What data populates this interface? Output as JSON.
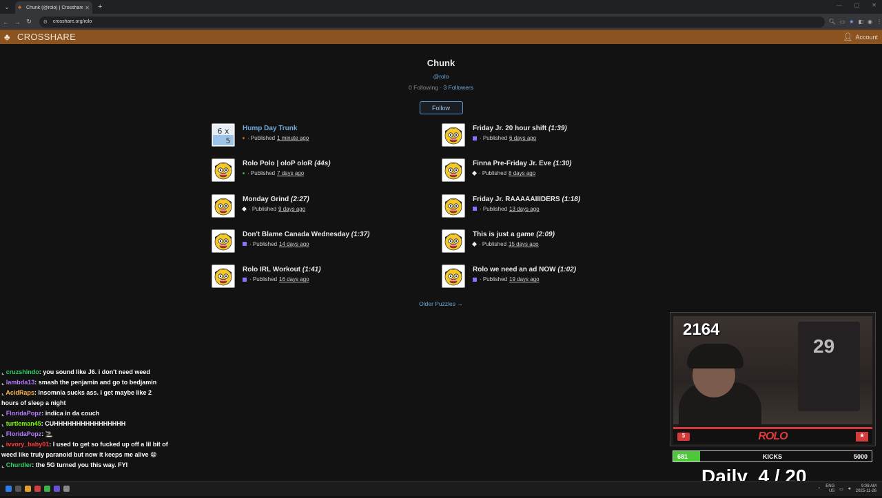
{
  "browser": {
    "tab_title": "Chunk (@rolo) | Crosshare Cro",
    "url": "crosshare.org/rolo"
  },
  "site": {
    "brand": "CROSSHARE",
    "account_label": "Account"
  },
  "profile": {
    "name": "Chunk",
    "handle": "@rolo",
    "following": "0 Following",
    "separator": " · ",
    "followers": "3 Followers",
    "follow_label": "Follow"
  },
  "puzzles": [
    {
      "title": "Hump Day Trunk",
      "time": "",
      "status": "orange",
      "ago": "1 minute ago",
      "thumb": "grid"
    },
    {
      "title": "Friday Jr. 20 hour shift",
      "time": "(1:39)",
      "status": "purple",
      "ago": "6 days ago",
      "thumb": "face"
    },
    {
      "title": "Rolo Polo | oloP oloR",
      "time": "(44s)",
      "status": "green",
      "ago": "7 days ago",
      "thumb": "face"
    },
    {
      "title": "Finna Pre-Friday Jr. Eve",
      "time": "(1:30)",
      "status": "diamond",
      "ago": "8 days ago",
      "thumb": "face"
    },
    {
      "title": "Monday Grind",
      "time": "(2:27)",
      "status": "diamond",
      "ago": "9 days ago",
      "thumb": "face"
    },
    {
      "title": "Friday Jr. RAAAAAIIIDERS",
      "time": "(1:18)",
      "status": "purple",
      "ago": "13 days ago",
      "thumb": "face"
    },
    {
      "title": "Don't Blame Canada Wednesday",
      "time": "(1:37)",
      "status": "purple",
      "ago": "14 days ago",
      "thumb": "face"
    },
    {
      "title": "This is just a game",
      "time": "(2:09)",
      "status": "diamond",
      "ago": "15 days ago",
      "thumb": "face"
    },
    {
      "title": "Rolo IRL Workout",
      "time": "(1:41)",
      "status": "purple",
      "ago": "16 days ago",
      "thumb": "face"
    },
    {
      "title": "Rolo we need an ad NOW",
      "time": "(1:02)",
      "status": "purple",
      "ago": "19 days ago",
      "thumb": "face"
    }
  ],
  "published_label": "· Published",
  "thumb_grid_text": "6 x 5",
  "older_label": "Older Puzzles →",
  "chat": [
    {
      "user": "cruzshindo",
      "color": "#2fd26a",
      "text": ": you sound like J6. i don't need weed"
    },
    {
      "user": "lambda13",
      "color": "#b57cff",
      "text": ": smash the penjamin and go to bedjamin"
    },
    {
      "user": "AcidRaps",
      "color": "#ffb347",
      "text": ": Insomnia sucks ass. I get maybe like 2 hours of sleep a night"
    },
    {
      "user": "FloridaPopz",
      "color": "#b57cff",
      "text": ": indica in da couch"
    },
    {
      "user": "turtleman45",
      "color": "#7cfc00",
      "text": ": CUHHHHHHHHHHHHHHHH"
    },
    {
      "user": "FloridaPopz",
      "color": "#b57cff",
      "text": ": 🚬"
    },
    {
      "user": "ivvory_baby01",
      "color": "#ff3b3b",
      "text": ": I used to get so fucked up off a lil bit of weed like truly paranoid but now it keeps me alive 😁"
    },
    {
      "user": "Churdler",
      "color": "#2fd26a",
      "text": ": the 5G turned you this way. FYI"
    }
  ],
  "stream": {
    "counter": "2164",
    "jersey_number": "29",
    "brand": "ROLO",
    "kicks_current": "681",
    "kicks_label": "KICKS",
    "kicks_goal": "5000",
    "kicks_fraction": 0.136,
    "daily_label": "Daily",
    "daily_value": "4 / 20"
  },
  "taskbar": {
    "locale_top": "ENG",
    "locale_bottom": "US",
    "time": "9:08 AM",
    "date": "2025-11-26"
  }
}
